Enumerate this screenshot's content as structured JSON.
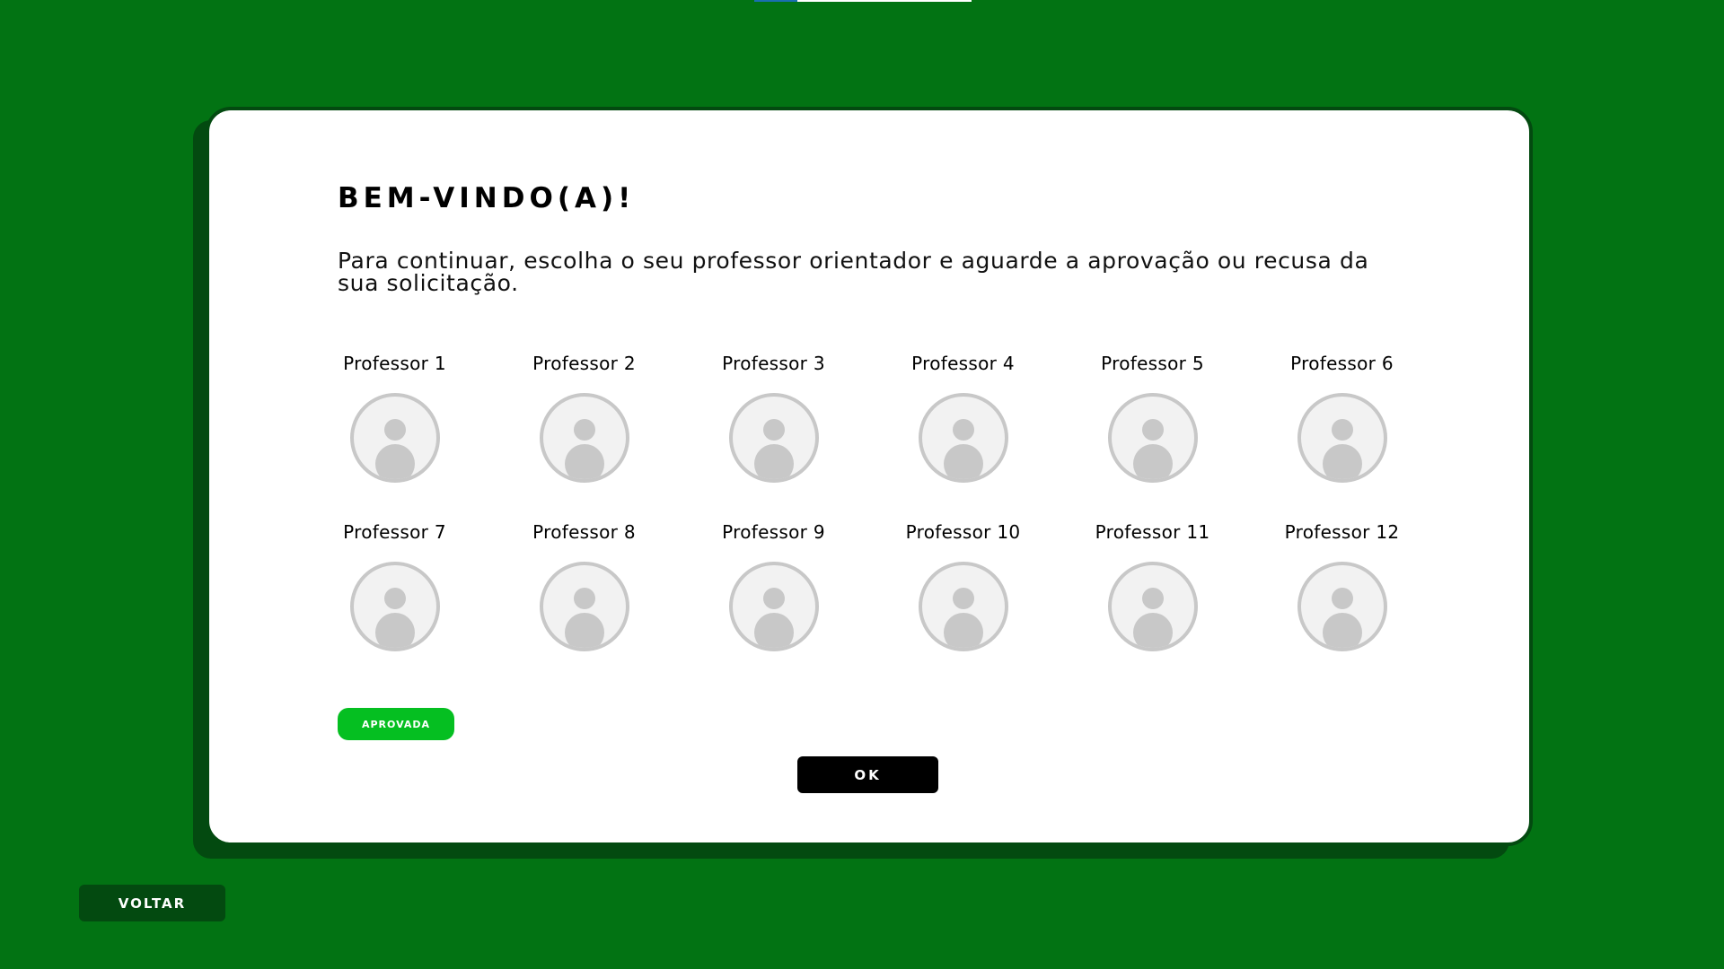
{
  "colors": {
    "background": "#027313",
    "card": "#ffffff",
    "card_border": "#034a10",
    "badge_approved": "#05bf21",
    "primary_button": "#000000",
    "back_button": "#034a10",
    "avatar_placeholder": "#c8c8c8"
  },
  "dialog": {
    "title": "BEM-VINDO(A)!",
    "message": "Para continuar, escolha o seu professor orientador e aguarde a aprovação ou recusa da sua solicitação.",
    "professors": [
      {
        "name": "Professor 1",
        "icon": "user-placeholder-icon"
      },
      {
        "name": "Professor 2",
        "icon": "user-placeholder-icon"
      },
      {
        "name": "Professor 3",
        "icon": "user-placeholder-icon"
      },
      {
        "name": "Professor 4",
        "icon": "user-placeholder-icon"
      },
      {
        "name": "Professor 5",
        "icon": "user-placeholder-icon"
      },
      {
        "name": "Professor 6",
        "icon": "user-placeholder-icon"
      },
      {
        "name": "Professor 7",
        "icon": "user-placeholder-icon"
      },
      {
        "name": "Professor 8",
        "icon": "user-placeholder-icon"
      },
      {
        "name": "Professor 9",
        "icon": "user-placeholder-icon"
      },
      {
        "name": "Professor 10",
        "icon": "user-placeholder-icon"
      },
      {
        "name": "Professor 11",
        "icon": "user-placeholder-icon"
      },
      {
        "name": "Professor 12",
        "icon": "user-placeholder-icon"
      }
    ],
    "status_badge": "APROVADA",
    "ok_label": "OK"
  },
  "footer": {
    "back_label": "VOLTAR"
  }
}
